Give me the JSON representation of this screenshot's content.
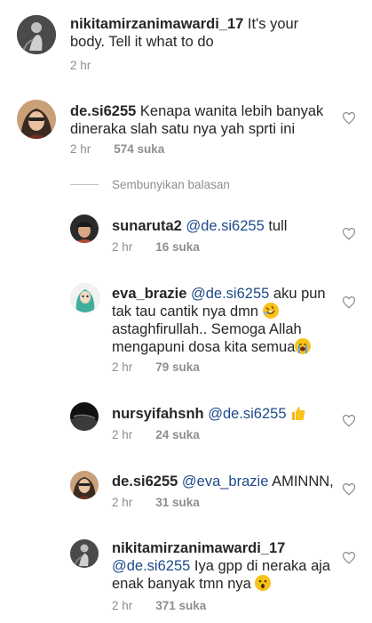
{
  "comments": [
    {
      "username": "nikitamirzanimawardi_17",
      "text": " It's your body. Tell it what to do",
      "time": "2 hr",
      "likes": ""
    },
    {
      "username": "de.si6255",
      "text": " Kenapa wanita lebih banyak dineraka slah satu nya yah sprti ini",
      "time": "2 hr",
      "likes": "574 suka"
    }
  ],
  "hide_replies_label": "Sembunyikan balasan",
  "replies": [
    {
      "username": "sunaruta2",
      "mention": "@de.si6255",
      "text": " tull",
      "time": "2 hr",
      "likes": "16 suka"
    },
    {
      "username": "eva_brazie",
      "mention": "@de.si6255",
      "text": " aku pun tak tau cantik nya dmn",
      "text2": "astaghfirullah.. Semoga Allah mengapuni dosa kita semua",
      "time": "2 hr",
      "likes": "79 suka"
    },
    {
      "username": "nursyifahsnh",
      "mention": "@de.si6255",
      "text": "",
      "time": "2 hr",
      "likes": "24 suka"
    },
    {
      "username": "de.si6255",
      "mention": "@eva_brazie",
      "text": " AMINNN,",
      "time": "2 hr",
      "likes": "31 suka"
    },
    {
      "username": "nikitamirzanimawardi_17",
      "mention": "@de.si6255",
      "text": " Iya gpp di neraka aja enak banyak tmn nya",
      "time": "2 hr",
      "likes": "371 suka"
    }
  ],
  "icons": {
    "like": "heart-outline-icon",
    "emoji_rolling": "rolling-on-floor-laughing-emoji",
    "emoji_crying": "loudly-crying-emoji",
    "emoji_thumbs": "thumbs-up-emoji",
    "emoji_surprised": "hushed-face-emoji"
  },
  "colors": {
    "text": "#262626",
    "meta": "#8e8e8e",
    "mention": "#1f4a8a"
  }
}
